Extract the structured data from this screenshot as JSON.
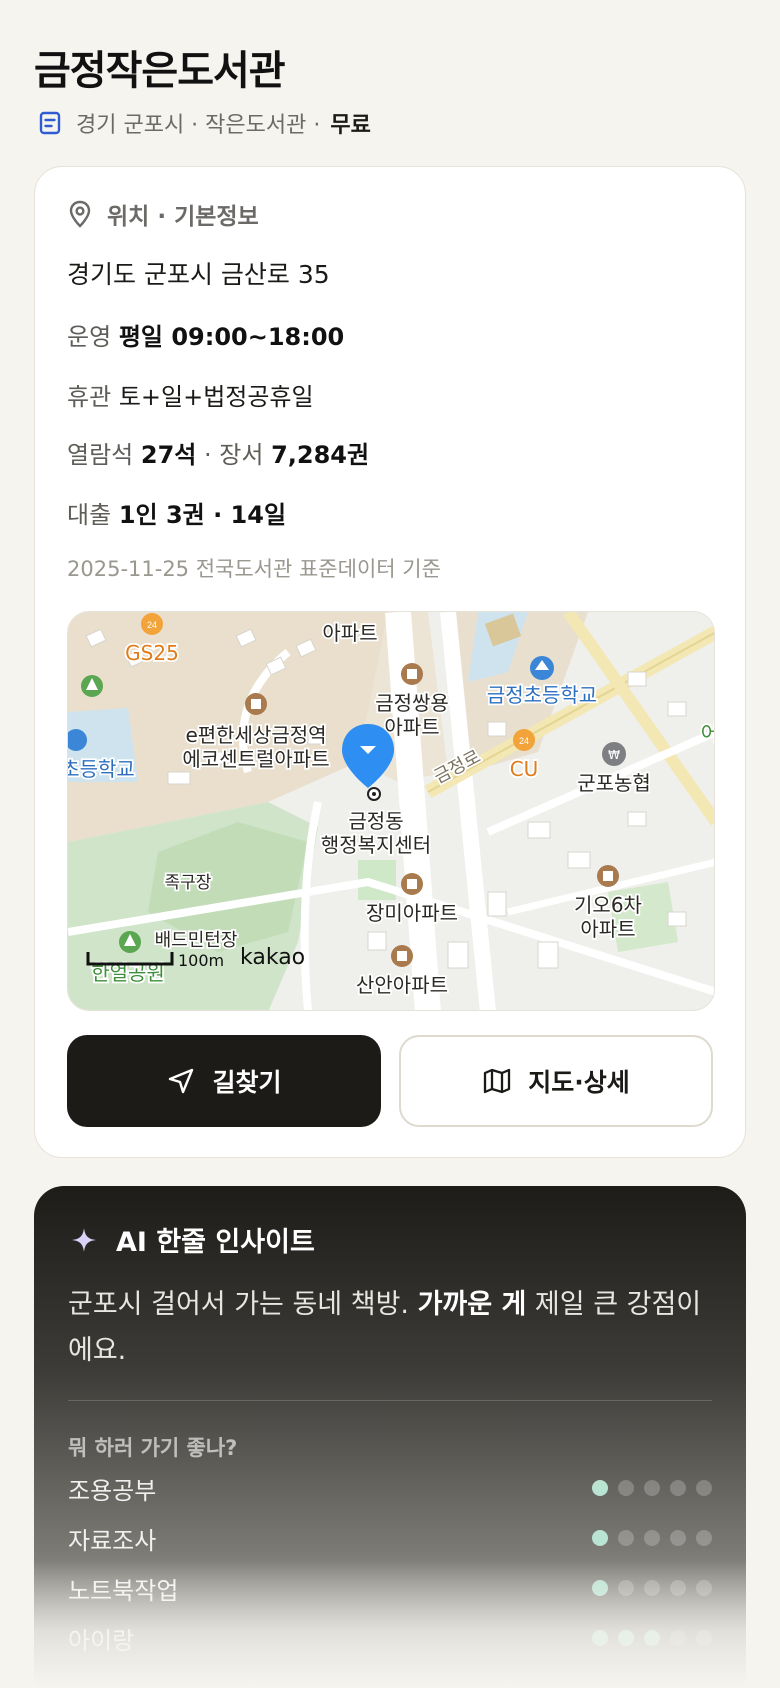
{
  "header": {
    "title": "금정작은도서관",
    "meta": "경기 군포시 · 작은도서관 ·",
    "fee": "무료"
  },
  "info": {
    "section_label": "위치 · 기본정보",
    "address": "경기도 군포시 금산로 35",
    "hours_label": "운영",
    "hours_value": "평일 09:00~18:00",
    "closed_label": "휴관",
    "closed_value": "토+일+법정공휴일",
    "seats_label": "열람석",
    "seats_value": "27석",
    "books_sep": " · 장서 ",
    "books_value": "7,284권",
    "loan_label": "대출",
    "loan_value": "1인 3권 · 14일",
    "source_note": "2025-11-25 전국도서관 표준데이터 기준"
  },
  "map": {
    "labels": {
      "apt_top": "아파트",
      "gs25": "GS25",
      "school_right": "금정초등학교",
      "geumjeong_ssangyong": "금정쌍용",
      "ssangyong_apt": "아파트",
      "epyeonhan_1": "e편한세상금정역",
      "epyeonhan_2": "에코센트럴아파트",
      "school_left": "초등학교",
      "road": "금정로",
      "cu": "CU",
      "nonghyup": "군포농협",
      "center_1": "금정동",
      "center_2": "행정복지센터",
      "jokgu": "족구장",
      "jangmi": "장미아파트",
      "giho_1": "기오6차",
      "giho_2": "아파트",
      "badminton": "배드민턴장",
      "park": "한얼공원",
      "scale": "100m",
      "brand": "kakao",
      "bottom_apt": "산안아파트",
      "edge_right": "어"
    }
  },
  "actions": {
    "directions_label": "길찾기",
    "map_detail_label": "지도·상세"
  },
  "ai": {
    "title": "AI 한줄 인사이트",
    "text_before": "군포시 걸어서 가는 동네 책방. ",
    "text_bold": "가까운 게",
    "text_after": " 제일 큰 강점이에요.",
    "question": "뭐 하러 가기 좋나?",
    "activities": [
      {
        "name": "조용공부",
        "score": 1
      },
      {
        "name": "자료조사",
        "score": 1
      },
      {
        "name": "노트북작업",
        "score": 1
      },
      {
        "name": "아이랑",
        "score": 3
      }
    ],
    "max_score": 5,
    "accent_color": "#b9e3d3"
  }
}
